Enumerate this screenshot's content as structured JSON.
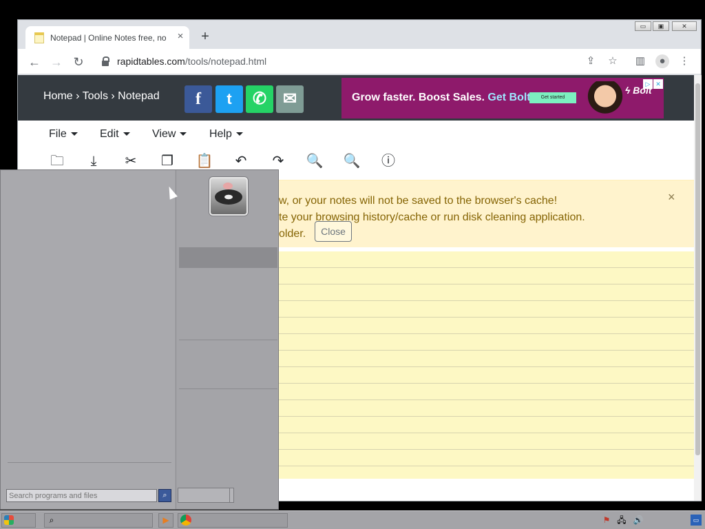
{
  "browser": {
    "tab_title": "Notepad | Online Notes free, no login",
    "tab_close": "×",
    "new_tab": "+",
    "url_host": "rapidtables.com",
    "url_path": "/tools/notepad.html",
    "window_controls": [
      "▭",
      "▣",
      "✕"
    ]
  },
  "page": {
    "breadcrumb": "Home › Tools › Notepad",
    "share": [
      {
        "name": "facebook",
        "glyph": "f",
        "color": "#3b5998"
      },
      {
        "name": "twitter",
        "glyph": "t",
        "color": "#1da1f2"
      },
      {
        "name": "whatsapp",
        "glyph": "✆",
        "color": "#25d366"
      },
      {
        "name": "email",
        "glyph": "✉",
        "color": "#7f9c95"
      }
    ],
    "ad": {
      "text_before": "Grow faster. Boost Sales. ",
      "text_bolt": "Get Bolt.",
      "cta": "Get started",
      "brand": "ϟ Bolt"
    },
    "menus": [
      "File",
      "Edit",
      "View",
      "Help"
    ],
    "alert": {
      "line1": "w, or your notes will not be saved to the browser's cache!",
      "line2": "te your browsing history/cache or run disk cleaning application.",
      "line3": "older.",
      "close_button": "Close",
      "dismiss": "×"
    }
  },
  "startmenu": {
    "search_placeholder": "Search programs and files"
  },
  "colors": {
    "header": "#343a40",
    "alert_bg": "#fff3cd",
    "notes_bg": "#fdf8c4",
    "startmenu": "#a4a4a8"
  }
}
